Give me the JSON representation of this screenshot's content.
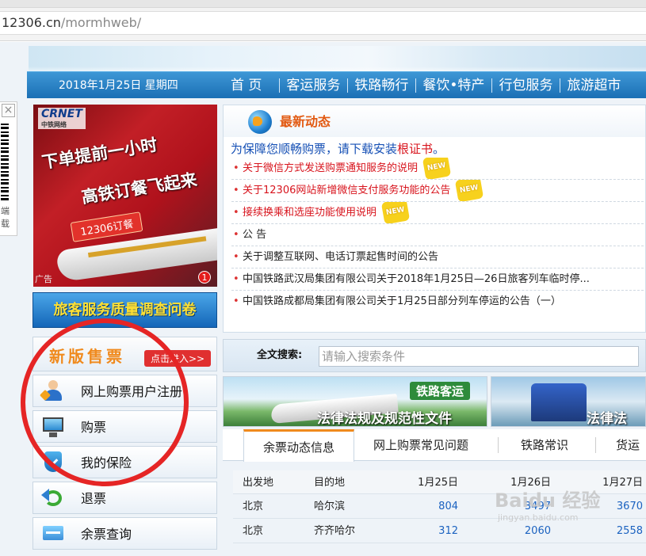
{
  "browser": {
    "url_host": "12306.cn",
    "url_path": "/mormhweb/"
  },
  "qr_widget": {
    "close_glyph": "×",
    "text": "端\n载"
  },
  "nav": {
    "date": "2018年1月25日 星期四",
    "items": [
      "首 页",
      "客运服务",
      "铁路畅行",
      "餐饮•特产",
      "行包服务",
      "旅游超市"
    ]
  },
  "ad": {
    "logo": "CRNET",
    "logo_sub": "中铁网络",
    "headline1": "下单提前一小时",
    "headline2": "高铁订餐飞起来",
    "tag": "12306订餐",
    "label": "广告",
    "badge": "1"
  },
  "survey_button": "旅客服务质量调查问卷",
  "new_ticket": {
    "title": "新版售票",
    "enter": "点击进入>>"
  },
  "side_menu": [
    {
      "label": "网上购票用户注册",
      "icon": "user-register-icon"
    },
    {
      "label": "购票",
      "icon": "computer-icon"
    },
    {
      "label": "我的保险",
      "icon": "shield-icon"
    },
    {
      "label": "退票",
      "icon": "refund-icon"
    },
    {
      "label": "余票查询",
      "icon": "ticket-query-icon"
    }
  ],
  "news": {
    "title": "最新动态",
    "notice_prefix": "为保障您顺畅购票，请下载安装",
    "notice_link": "根证书",
    "notice_suffix": "。",
    "new_tag": "NEW",
    "items": [
      {
        "text": "关于微信方式发送购票通知服务的说明",
        "hot": true,
        "is_new": true
      },
      {
        "text": "关于12306网站新增微信支付服务功能的公告",
        "hot": true,
        "is_new": true
      },
      {
        "text": "接续换乘和选座功能使用说明",
        "hot": true,
        "is_new": true
      },
      {
        "text": "公 告",
        "hot": false,
        "is_new": false
      },
      {
        "text": "关于调整互联网、电话订票起售时间的公告",
        "hot": false,
        "is_new": false
      },
      {
        "text": "中国铁路武汉局集团有限公司关于2018年1月25日—26日旅客列车临时停...",
        "hot": false,
        "is_new": false
      },
      {
        "text": "中国铁路成都局集团有限公司关于1月25日部分列车停运的公告（一）",
        "hot": false,
        "is_new": false
      }
    ]
  },
  "search": {
    "label": "全文搜索:",
    "placeholder": "请输入搜索条件"
  },
  "rail_banners": [
    {
      "tag": "铁路客运",
      "title": "法律法规及规范性文件"
    },
    {
      "tag": "",
      "title": "法律法"
    }
  ],
  "tabs": [
    "余票动态信息",
    "网上购票常见问题",
    "铁路常识",
    "货运"
  ],
  "ticket_table": {
    "headers": [
      "出发地",
      "目的地",
      "1月25日",
      "1月26日",
      "1月27日"
    ],
    "rows": [
      [
        "北京",
        "哈尔滨",
        "804",
        "3497",
        "3670"
      ],
      [
        "北京",
        "齐齐哈尔",
        "312",
        "2060",
        "2558"
      ]
    ]
  },
  "watermark": {
    "main": "Baidu 经验",
    "sub": "jingyan.baidu.com"
  },
  "colors": {
    "nav_blue": "#1b6fb5",
    "accent_orange": "#f08a1d",
    "alert_red": "#d8141d",
    "annotation_red": "#e52525"
  }
}
